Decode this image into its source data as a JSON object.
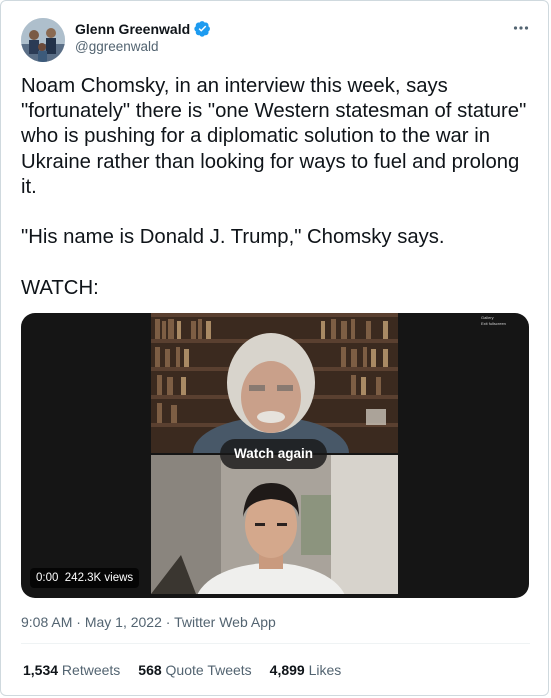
{
  "author": {
    "name": "Glenn Greenwald",
    "handle": "@ggreenwald",
    "verified_color": "#1d9bf0"
  },
  "tweet": {
    "paragraphs": [
      "Noam Chomsky, in an interview this week, says \"fortunately\" there is \"one Western statesman of stature\" who is pushing for a diplomatic solution to the war in Ukraine rather than looking for ways to fuel and prolong it.",
      "\"His name is Donald J. Trump,\" Chomsky says.",
      "WATCH:"
    ]
  },
  "media": {
    "watch_again": "Watch again",
    "time": "0:00",
    "views": "242.3K views",
    "overlay_lines": [
      "Gallery",
      "Exit fullscreen"
    ]
  },
  "meta": {
    "time": "9:08 AM",
    "separator": " · ",
    "date": "May 1, 2022",
    "source": "Twitter Web App"
  },
  "stats": {
    "retweets_count": "1,534",
    "retweets_label": " Retweets",
    "quotes_count": "568",
    "quotes_label": " Quote Tweets",
    "likes_count": "4,899",
    "likes_label": " Likes"
  },
  "icons": {
    "verified": "verified-badge-icon",
    "more": "more-options-icon"
  }
}
